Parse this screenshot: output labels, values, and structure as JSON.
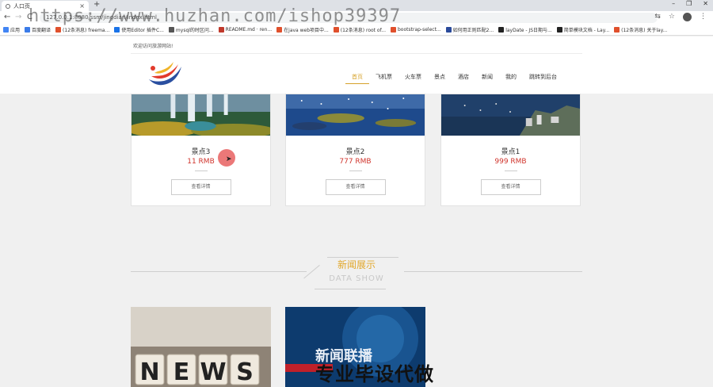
{
  "browser": {
    "tab_title": "人口页",
    "tab_close": "×",
    "new_tab": "+",
    "url": "127.0.0.1:8080/ssm/jingdian/index.html",
    "window_controls": [
      "–",
      "❐",
      "✕"
    ],
    "nav_back": "←",
    "nav_forward": "→",
    "nav_reload": "C"
  },
  "bookmarks": [
    {
      "label": "应用",
      "color": "#4285f4"
    },
    {
      "label": "百度翻译",
      "color": "#3b7be8"
    },
    {
      "label": "(12条消息) freema...",
      "color": "#e0502c"
    },
    {
      "label": "使用Editor 插件C...",
      "color": "#1a73e8"
    },
    {
      "label": "mysql的时区问...",
      "color": "#555555"
    },
    {
      "label": "README.md · ren...",
      "color": "#c0392b"
    },
    {
      "label": "在java web项目中...",
      "color": "#e0502c"
    },
    {
      "label": "(12条消息) root of...",
      "color": "#e0502c"
    },
    {
      "label": "bootstrap-select...",
      "color": "#e0502c"
    },
    {
      "label": "如何用正则匹配2...",
      "color": "#2a4a9b"
    },
    {
      "label": "layDate - JS日期与...",
      "color": "#222222"
    },
    {
      "label": "简单模块文档 - Lay...",
      "color": "#222222"
    },
    {
      "label": "(12条消息) 关于lay...",
      "color": "#e0502c"
    }
  ],
  "header": {
    "welcome": "欢迎访问旅游网站!",
    "nav": [
      {
        "label": "首页",
        "active": true
      },
      {
        "label": "飞机票",
        "active": false
      },
      {
        "label": "火车票",
        "active": false
      },
      {
        "label": "景点",
        "active": false
      },
      {
        "label": "酒店",
        "active": false
      },
      {
        "label": "新闻",
        "active": false
      },
      {
        "label": "我的",
        "active": false
      },
      {
        "label": "跳转到后台",
        "active": false
      }
    ]
  },
  "spots": [
    {
      "name": "景点3",
      "price": "11 RMB",
      "button": "查看详情"
    },
    {
      "name": "景点2",
      "price": "777 RMB",
      "button": "查看详情"
    },
    {
      "name": "景点1",
      "price": "999 RMB",
      "button": "查看详情"
    }
  ],
  "news_section": {
    "title": "新闻展示",
    "subtitle": "DATA SHOW"
  },
  "news_images": [
    {
      "text": "NEWS"
    },
    {
      "text": "新闻联播"
    }
  ],
  "watermarks": {
    "url": "https://www.huzhan.com/ishop39397",
    "bottom": "专业毕设代做"
  },
  "colors": {
    "accent": "#d6a22a",
    "price": "#d0342c",
    "section_title": "#e2a82c"
  }
}
